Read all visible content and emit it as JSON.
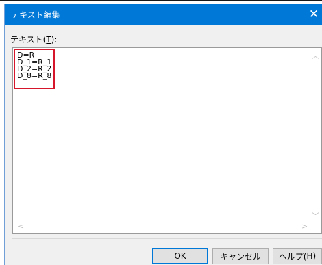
{
  "window": {
    "title": "テキスト編集",
    "close_glyph": "✕"
  },
  "field": {
    "label_prefix": "テキスト(",
    "label_mnemonic": "T",
    "label_suffix": "):"
  },
  "textbox": {
    "content": "D=R\nD_1=R_1\nD_2=R_2\nD_8=R_8",
    "highlight_color": "#d6172b"
  },
  "scrollbars": {
    "up_glyph": "︿",
    "down_glyph": "﹀",
    "left_glyph": "<",
    "right_glyph": ">"
  },
  "buttons": {
    "ok_label": "OK",
    "cancel_label": "キャンセル",
    "help_prefix": "ヘルプ(",
    "help_mnemonic": "H",
    "help_suffix": ")"
  },
  "colors": {
    "titlebar": "#0078d7",
    "dialog_bg": "#f0f0f0"
  }
}
